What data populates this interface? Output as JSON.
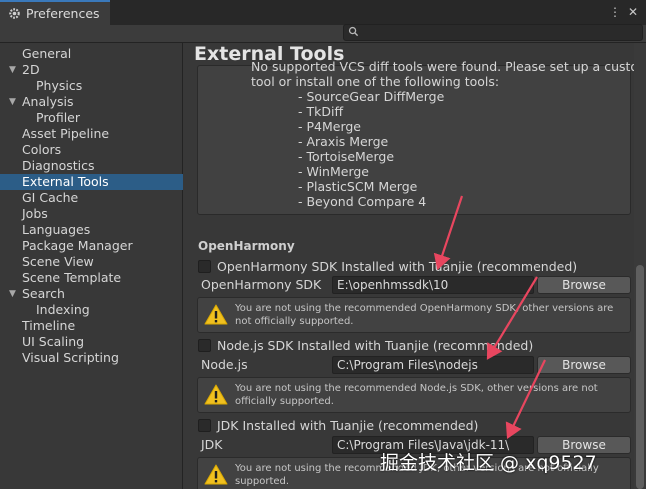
{
  "window": {
    "tab_title": "Preferences",
    "menu_glyph": "⋮",
    "close_glyph": "✕"
  },
  "search": {
    "placeholder": ""
  },
  "sidebar": {
    "items": [
      {
        "label": "General",
        "indent": 0,
        "arrow": ""
      },
      {
        "label": "2D",
        "indent": 0,
        "arrow": "▼"
      },
      {
        "label": "Physics",
        "indent": 1,
        "arrow": ""
      },
      {
        "label": "Analysis",
        "indent": 0,
        "arrow": "▼"
      },
      {
        "label": "Profiler",
        "indent": 1,
        "arrow": ""
      },
      {
        "label": "Asset Pipeline",
        "indent": 0,
        "arrow": ""
      },
      {
        "label": "Colors",
        "indent": 0,
        "arrow": ""
      },
      {
        "label": "Diagnostics",
        "indent": 0,
        "arrow": ""
      },
      {
        "label": "External Tools",
        "indent": 0,
        "arrow": "",
        "selected": true
      },
      {
        "label": "GI Cache",
        "indent": 0,
        "arrow": ""
      },
      {
        "label": "Jobs",
        "indent": 0,
        "arrow": ""
      },
      {
        "label": "Languages",
        "indent": 0,
        "arrow": ""
      },
      {
        "label": "Package Manager",
        "indent": 0,
        "arrow": ""
      },
      {
        "label": "Scene View",
        "indent": 0,
        "arrow": ""
      },
      {
        "label": "Scene Template",
        "indent": 0,
        "arrow": ""
      },
      {
        "label": "Search",
        "indent": 0,
        "arrow": "▼"
      },
      {
        "label": "Indexing",
        "indent": 1,
        "arrow": ""
      },
      {
        "label": "Timeline",
        "indent": 0,
        "arrow": ""
      },
      {
        "label": "UI Scaling",
        "indent": 0,
        "arrow": ""
      },
      {
        "label": "Visual Scripting",
        "indent": 0,
        "arrow": ""
      }
    ]
  },
  "main": {
    "title": "External Tools",
    "vcs_message": [
      "No supported VCS diff tools were found. Please set up a custom",
      "tool or install one of the following tools:"
    ],
    "tools": [
      "- SourceGear DiffMerge",
      "- TkDiff",
      "- P4Merge",
      "- Araxis Merge",
      "- TortoiseMerge",
      "- WinMerge",
      "- PlasticSCM Merge",
      "- Beyond Compare 4"
    ],
    "section_title": "OpenHarmony",
    "sdk_blocks": [
      {
        "checkbox_label": "OpenHarmony SDK Installed with Tuanjie (recommended)",
        "field_label": "OpenHarmony SDK",
        "field_value": "E:\\openhmssdk\\10",
        "browse_label": "Browse",
        "warning": "You are not using the recommended OpenHarmony SDK, other versions are not officially supported."
      },
      {
        "checkbox_label": "Node.js SDK Installed with Tuanjie (recommended)",
        "field_label": "Node.js",
        "field_value": "C:\\Program Files\\nodejs",
        "browse_label": "Browse",
        "warning": "You are not using the recommended Node.js SDK, other versions are not officially supported."
      },
      {
        "checkbox_label": "JDK Installed with Tuanjie (recommended)",
        "field_label": "JDK",
        "field_value": "C:\\Program Files\\Java\\jdk-11\\",
        "browse_label": "Browse",
        "warning": "You are not using the recommended JDK, other versions are not officially supported."
      }
    ]
  },
  "watermark": "掘金技术社区 @ xq9527",
  "colors": {
    "selection": "#2c5d87",
    "annotation_arrow": "#e8465f",
    "warning_yellow": "#f0c020"
  }
}
